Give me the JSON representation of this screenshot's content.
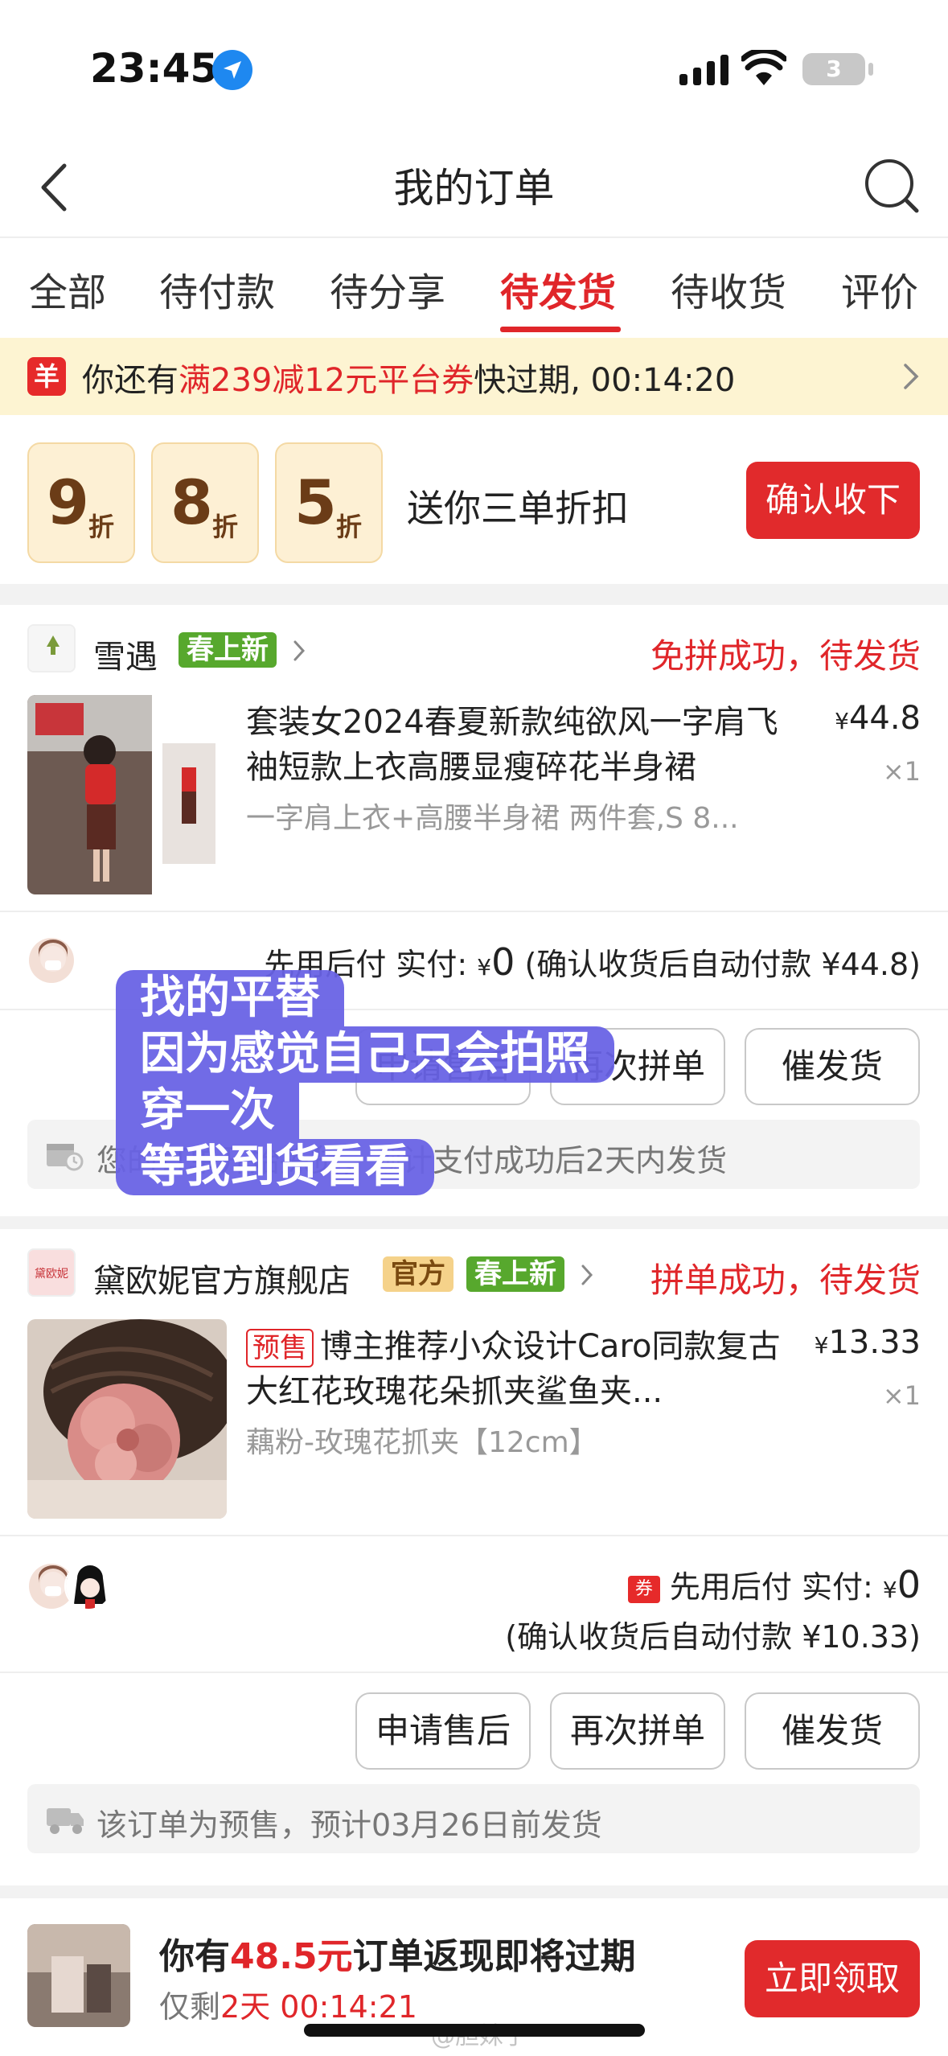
{
  "status_bar": {
    "time": "23:45",
    "battery": "3"
  },
  "nav": {
    "title": "我的订单"
  },
  "tabs": [
    "全部",
    "待付款",
    "待分享",
    "待发货",
    "待收货",
    "评价"
  ],
  "active_tab": "待发货",
  "coupon_banner": {
    "icon_text": "羊",
    "prefix": "你还有",
    "highlight": "满239减12元平台券",
    "suffix": "快过期, 00:14:20"
  },
  "discount_strip": {
    "tickets": [
      {
        "num": "9",
        "unit": "折"
      },
      {
        "num": "8",
        "unit": "折"
      },
      {
        "num": "5",
        "unit": "折"
      }
    ],
    "text": "送你三单折扣",
    "button": "确认收下"
  },
  "orders": [
    {
      "shop_name": "雪遇",
      "logo_text": "雪遇",
      "badges": [
        "春上新"
      ],
      "status": "免拼成功，待发货",
      "product_title": "套装女2024春夏新款纯欲风一字肩飞袖短款上衣高腰显瘦碎花半身裙",
      "sku": "一字肩上衣+高腰半身裙 两件套,S 8...",
      "price_symbol": "¥",
      "price": "44.8",
      "qty": "×1",
      "pay_label": "先用后付 实付: ",
      "pay_symbol": "¥",
      "pay_value": "0",
      "pay_note": " (确认收货后自动付款 ¥44.8)",
      "actions": [
        "申请售后",
        "再次拼单",
        "催发货"
      ],
      "notice": "您的订单开始拣货，预计支付成功后2天内发货"
    },
    {
      "shop_name": "黛欧妮官方旗舰店",
      "logo_text": "黛欧妮",
      "badges": [
        "官方",
        "春上新"
      ],
      "status": "拼单成功，待发货",
      "presale_tag": "预售",
      "product_title": "博主推荐小众设计Caro同款复古大红花玫瑰花朵抓夹鲨鱼夹...",
      "sku": "藕粉-玫瑰花抓夹【12cm】",
      "price_symbol": "¥",
      "price": "13.33",
      "qty": "×1",
      "coupon_mini": "券",
      "pay_label": "先用后付 实付: ",
      "pay_symbol": "¥",
      "pay_value": "0",
      "pay_note": "(确认收货后自动付款 ¥10.33)",
      "actions": [
        "申请售后",
        "再次拼单",
        "催发货"
      ],
      "notice": "该订单为预售，预计03月26日前发货"
    }
  ],
  "cashback": {
    "title_prefix": "你有",
    "title_amount": "48.5元",
    "title_suffix": "订单返现即将过期",
    "sub_prefix": "仅剩",
    "sub_days": "2天",
    "sub_time": " 00:14:21",
    "button": "立即领取"
  },
  "overlay_note": {
    "lines": [
      "找的平替",
      "因为感觉自己只会拍照",
      "穿一次",
      "等我到货看看"
    ]
  },
  "watermark": "@胆妹子",
  "colors": {
    "accent_red": "#e0262a",
    "button_red": "#e12a2c",
    "overlay_purple": "#6862e4",
    "banner_yellow": "#fdf4d2"
  }
}
